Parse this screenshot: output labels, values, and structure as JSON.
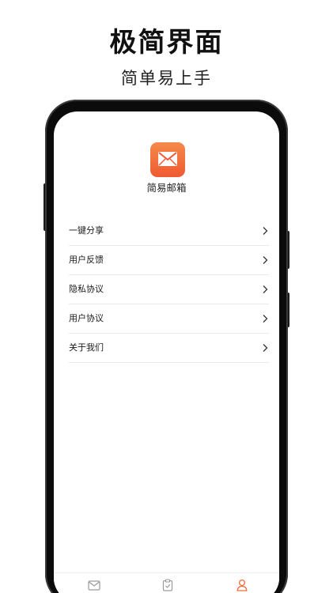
{
  "promo": {
    "title": "极简界面",
    "subtitle": "简单易上手"
  },
  "app": {
    "name": "简易邮箱",
    "logo_icon": "mail-envelope-icon",
    "logo_color": "#F06A3A"
  },
  "menu": {
    "items": [
      {
        "label": "一键分享",
        "icon": "chevron-right-icon"
      },
      {
        "label": "用户反馈",
        "icon": "chevron-right-icon"
      },
      {
        "label": "隐私协议",
        "icon": "chevron-right-icon"
      },
      {
        "label": "用户协议",
        "icon": "chevron-right-icon"
      },
      {
        "label": "关于我们",
        "icon": "chevron-right-icon"
      }
    ]
  },
  "tab_bar": {
    "tabs": [
      {
        "icon": "mail-icon",
        "active": false
      },
      {
        "icon": "clipboard-check-icon",
        "active": false
      },
      {
        "icon": "user-icon",
        "active": true
      }
    ],
    "active_color": "#F06A3A",
    "inactive_color": "#9A9A9A"
  }
}
